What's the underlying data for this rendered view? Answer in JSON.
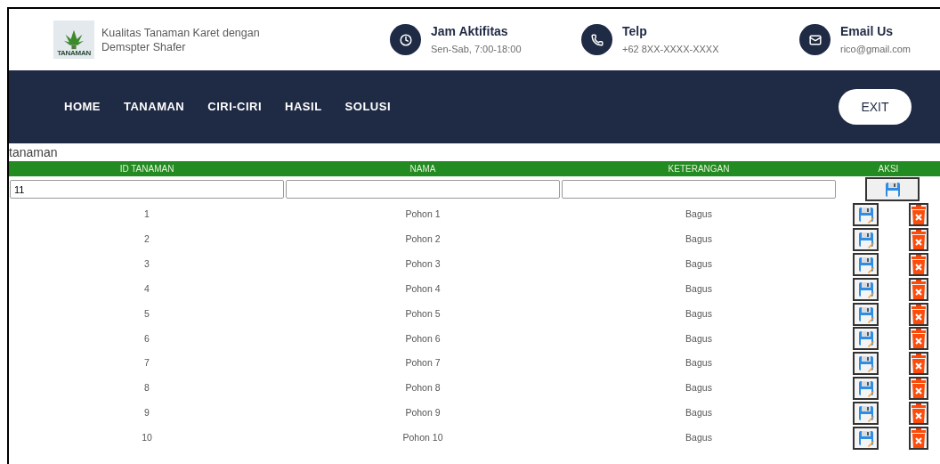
{
  "header": {
    "logo_text": "TANAMAN",
    "title": "Kualitas Tanaman Karet dengan Demspter Shafer",
    "contacts": [
      {
        "kind": "clock",
        "title": "Jam Aktifitas",
        "detail": "Sen-Sab, 7:00-18:00"
      },
      {
        "kind": "phone",
        "title": "Telp",
        "detail": "+62 8XX-XXXX-XXXX"
      },
      {
        "kind": "mail",
        "title": "Email Us",
        "detail": "rico@gmail.com"
      }
    ]
  },
  "nav": {
    "items": [
      "HOME",
      "TANAMAN",
      "CIRI-CIRI",
      "HASIL",
      "SOLUSI"
    ],
    "exit": "EXIT"
  },
  "section_title": "tanaman",
  "table": {
    "columns": [
      "ID TANAMAN",
      "NAMA",
      "KETERANGAN",
      "AKSI"
    ],
    "new_row": {
      "id": "11"
    },
    "rows": [
      {
        "id": "1",
        "nama": "Pohon 1",
        "keterangan": "Bagus"
      },
      {
        "id": "2",
        "nama": "Pohon 2",
        "keterangan": "Bagus"
      },
      {
        "id": "3",
        "nama": "Pohon 3",
        "keterangan": "Bagus"
      },
      {
        "id": "4",
        "nama": "Pohon 4",
        "keterangan": "Bagus"
      },
      {
        "id": "5",
        "nama": "Pohon 5",
        "keterangan": "Bagus"
      },
      {
        "id": "6",
        "nama": "Pohon 6",
        "keterangan": "Bagus"
      },
      {
        "id": "7",
        "nama": "Pohon 7",
        "keterangan": "Bagus"
      },
      {
        "id": "8",
        "nama": "Pohon 8",
        "keterangan": "Bagus"
      },
      {
        "id": "9",
        "nama": "Pohon 9",
        "keterangan": "Bagus"
      },
      {
        "id": "10",
        "nama": "Pohon 10",
        "keterangan": "Bagus"
      }
    ]
  }
}
